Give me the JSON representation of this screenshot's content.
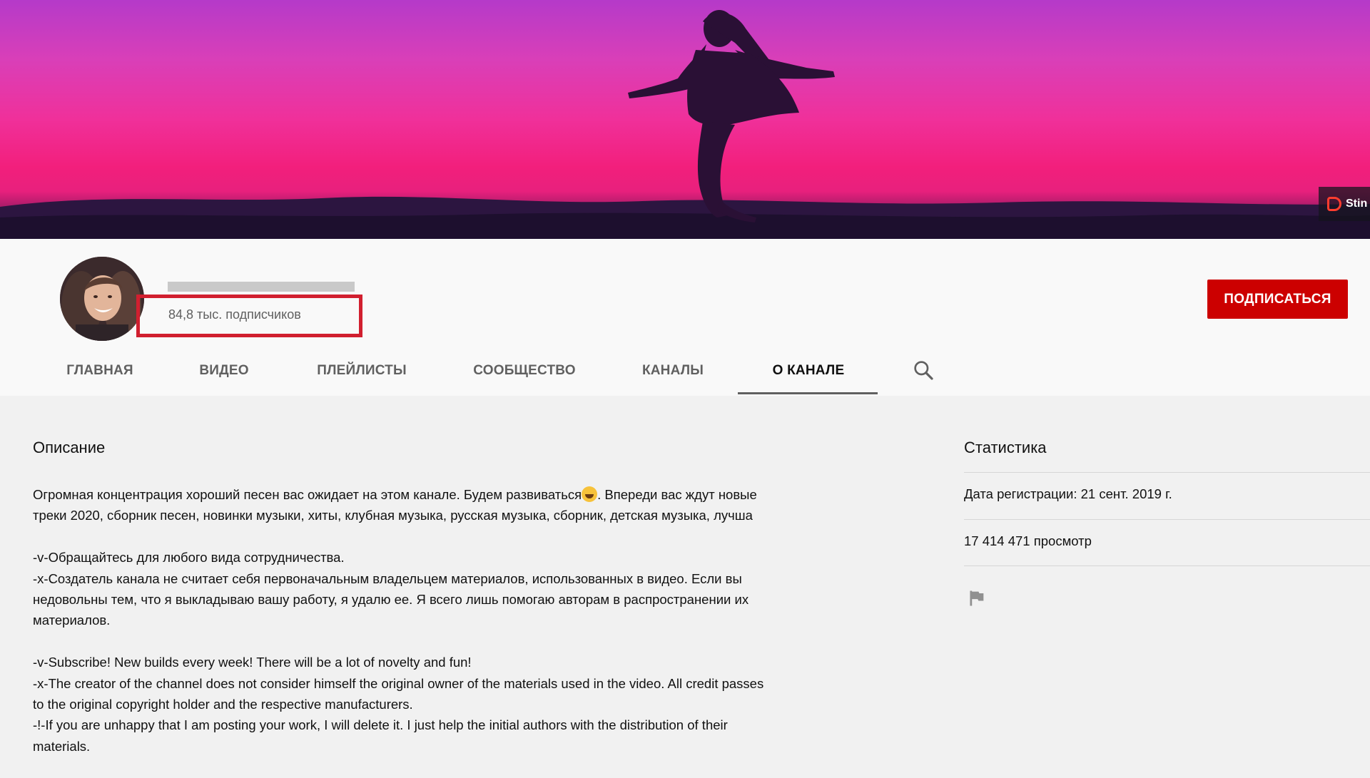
{
  "banner": {
    "watermark_text": "Stin"
  },
  "channel": {
    "subscribers": "84,8 тыс. подписчиков",
    "subscribe_label": "ПОДПИСАТЬСЯ"
  },
  "tabs": [
    {
      "label": "ГЛАВНАЯ"
    },
    {
      "label": "ВИДЕО"
    },
    {
      "label": "ПЛЕЙЛИСТЫ"
    },
    {
      "label": "СООБЩЕСТВО"
    },
    {
      "label": "КАНАЛЫ"
    },
    {
      "label": "О КАНАЛЕ"
    }
  ],
  "description": {
    "title": "Описание",
    "line1a": "Огромная концентрация хороший песен вас ожидает на этом канале. Будем развиваться",
    "line1b": ". Впереди вас ждут новые",
    "line2": "треки 2020, сборник песен, новинки музыки, хиты, клубная музыка, русская музыка, сборник, детская музыка, лучша",
    "line3": "-v-Обращайтесь для любого вида сотрудничества.",
    "line4": "-x-Создатель канала не считает себя первоначальным владельцем материалов, использованных в видео. Если вы",
    "line5": "недовольны тем, что я выкладываю вашу работу, я удалю ее. Я всего лишь помогаю авторам в распространении их",
    "line6": "материалов.",
    "line7": "-v-Subscribe! New builds every week! There will be a lot of novelty and fun!",
    "line8": "-x-The creator of the channel does not consider himself the original owner of the materials used in the video. All credit passes",
    "line9": "to the original copyright holder and the respective manufacturers.",
    "line10": "-!-If you are unhappy that I am posting your work, I will delete it. I just help the initial authors with the distribution of their",
    "line11": "materials."
  },
  "stats": {
    "title": "Статистика",
    "registered": "Дата регистрации: 21 сент. 2019 г.",
    "views": "17 414 471 просмотр"
  },
  "colors": {
    "subscribe_bg": "#cc0000",
    "highlight_box": "#d11f2f"
  }
}
